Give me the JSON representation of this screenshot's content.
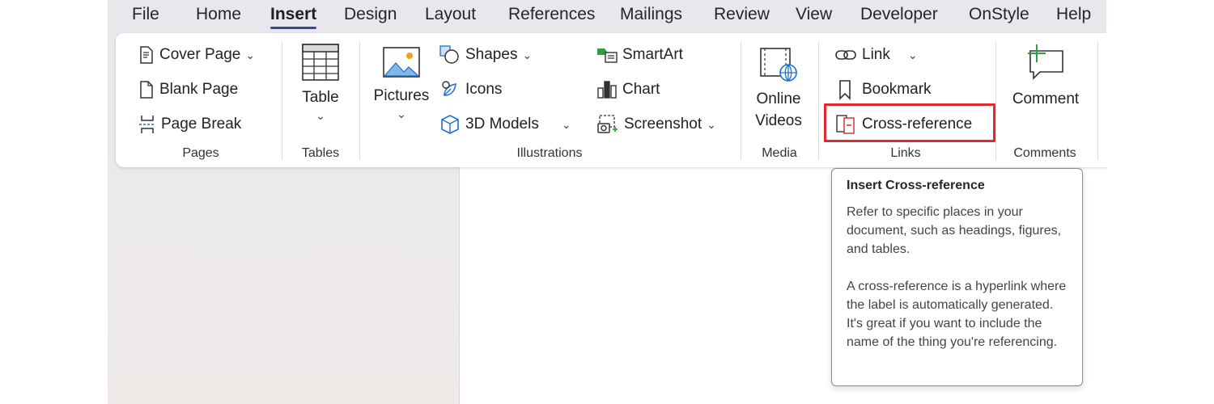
{
  "menu": {
    "tabs": [
      "File",
      "Home",
      "Insert",
      "Design",
      "Layout",
      "References",
      "Mailings",
      "Review",
      "View",
      "Developer",
      "OnStyle",
      "Help"
    ],
    "active": "Insert"
  },
  "ribbon": {
    "pages": {
      "label": "Pages",
      "cover_page": "Cover Page",
      "blank_page": "Blank Page",
      "page_break": "Page Break"
    },
    "tables": {
      "label": "Tables",
      "table": "Table"
    },
    "illustrations": {
      "label": "Illustrations",
      "pictures": "Pictures",
      "shapes": "Shapes",
      "icons": "Icons",
      "models_3d": "3D Models",
      "smartart": "SmartArt",
      "chart": "Chart",
      "screenshot": "Screenshot"
    },
    "media": {
      "label": "Media",
      "online_videos_1": "Online",
      "online_videos_2": "Videos"
    },
    "links": {
      "label": "Links",
      "link": "Link",
      "bookmark": "Bookmark",
      "cross_reference": "Cross-reference"
    },
    "comments": {
      "label": "Comments",
      "comment": "Comment"
    },
    "chevron": "⌄"
  },
  "tooltip": {
    "title": "Insert Cross-reference",
    "para1": "Refer to specific places in your document, such as headings, figures, and tables.",
    "para2": "A cross-reference is a hyperlink where the label is automatically generated. It's great if you want to include the name of the thing you're referencing."
  },
  "colors": {
    "accent": "#2a4f9e",
    "icon_blue": "#1e6fd0",
    "icon_green": "#2f9e44",
    "icon_red": "#d13438",
    "highlight": "#e02a2f"
  }
}
